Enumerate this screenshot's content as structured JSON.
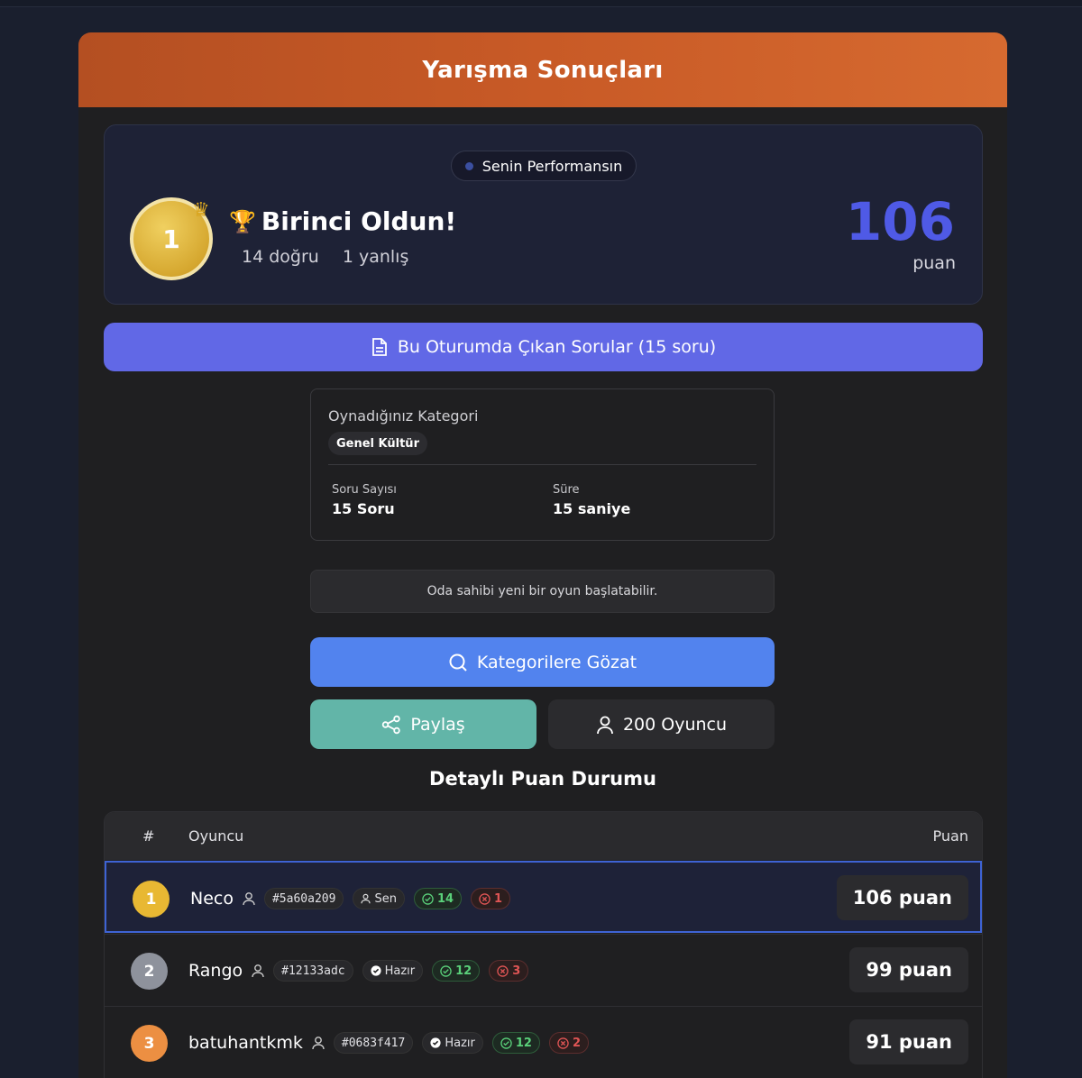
{
  "header": {
    "title": "Yarışma Sonuçları"
  },
  "performance": {
    "pill_label": "Senin Performansın",
    "rank": "1",
    "title": "Birinci Oldun!",
    "correct": "14 doğru",
    "wrong": "1 yanlış",
    "score": "106",
    "score_unit": "puan"
  },
  "questions_button": {
    "label": "Bu Oturumda Çıkan Sorular (15 soru)"
  },
  "category": {
    "label": "Oynadığınız Kategori",
    "tag": "Genel Kültür",
    "count_label": "Soru Sayısı",
    "count_value": "15 Soru",
    "time_label": "Süre",
    "time_value": "15 saniye"
  },
  "notice": "Oda sahibi yeni bir oyun başlatabilir.",
  "browse_button": {
    "label": "Kategorilere Gözat"
  },
  "share_button": {
    "label": "Paylaş"
  },
  "players_button": {
    "label": "200 Oyuncu"
  },
  "leaderboard": {
    "title": "Detaylı Puan Durumu",
    "columns": {
      "rank": "#",
      "player": "Oyuncu",
      "score": "Puan"
    },
    "rows": [
      {
        "rank": "1",
        "name": "Neco",
        "id": "#5a60a209",
        "role": "Sen",
        "correct": "14",
        "wrong": "1",
        "score": "106 puan"
      },
      {
        "rank": "2",
        "name": "Rango",
        "id": "#12133adc",
        "role": "Hazır",
        "correct": "12",
        "wrong": "3",
        "score": "99 puan"
      },
      {
        "rank": "3",
        "name": "batuhantkmk",
        "id": "#0683f417",
        "role": "Hazır",
        "correct": "12",
        "wrong": "2",
        "score": "91 puan"
      }
    ]
  },
  "colors": {
    "accent_orange": "#c85a26",
    "primary_purple": "#6168e6",
    "primary_blue": "#5283ee",
    "teal": "#62b5a8",
    "score_blue": "#4f5ae6",
    "gold": "#e8b833",
    "silver": "#8e929c",
    "bronze": "#ec8f42"
  }
}
